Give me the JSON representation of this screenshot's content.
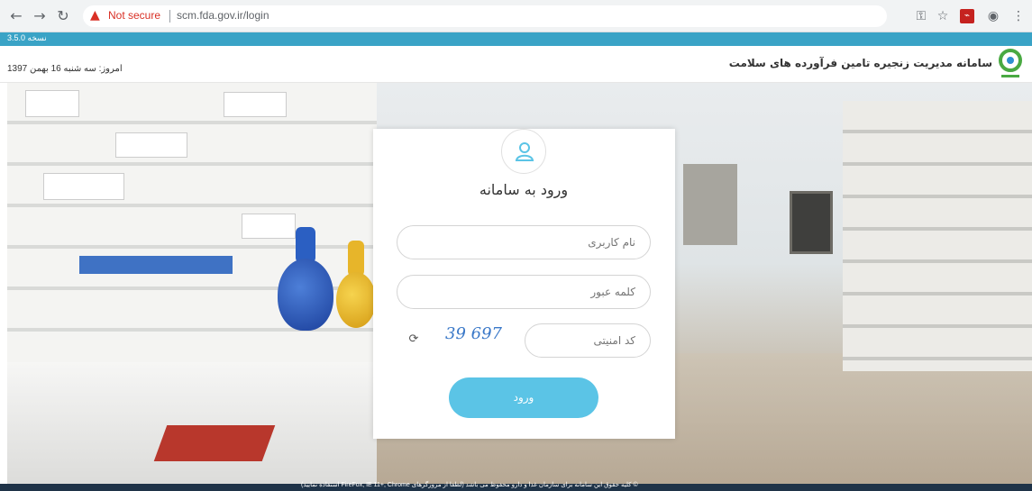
{
  "browser": {
    "security_label": "Not secure",
    "url": "scm.fda.gov.ir/login"
  },
  "site": {
    "version": "3.5.0 نسخه",
    "date": "امروز: سه شنبه 16 بهمن 1397",
    "title": "سامانه مدیریت زنجیره تامین فرآورده های سلامت"
  },
  "login": {
    "title": "ورود به سامانه",
    "username_placeholder": "نام کاربری",
    "password_placeholder": "کلمه عبور",
    "captcha_placeholder": "کد امنیتی",
    "captcha_text": "39 697",
    "submit_label": "ورود"
  },
  "footer": {
    "text": "© کلیه حقوق این سامانه برای سازمان غذا و دارو محفوظ می باشد (لطفا از مرورگرهای FireFox, IE 11+, Chrome استفاده نمایید)"
  },
  "colors": {
    "accent": "#3aa3c6",
    "button": "#5bc4e6",
    "footer": "#1f3348",
    "warning": "#d93025"
  },
  "icons": {
    "back": "arrow-left",
    "forward": "arrow-right",
    "reload": "reload",
    "warning": "warning-triangle",
    "key": "key",
    "bookmark": "star",
    "pdf": "pdf",
    "profile": "account-circle",
    "menu": "kebab",
    "user": "user",
    "refresh": "refresh"
  }
}
